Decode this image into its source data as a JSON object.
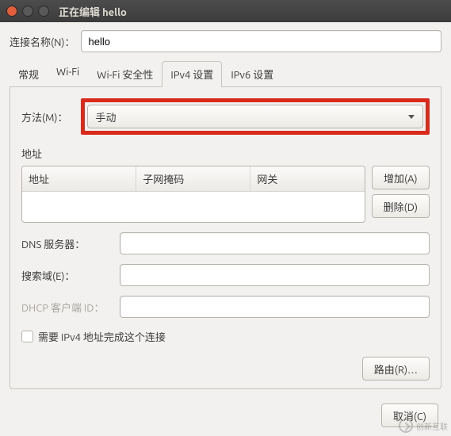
{
  "window": {
    "title": "正在编辑 hello"
  },
  "connection": {
    "label": "连接名称(N)：",
    "value": "hello"
  },
  "tabs": {
    "items": [
      {
        "label": "常规"
      },
      {
        "label": "Wi-Fi"
      },
      {
        "label": "Wi-Fi 安全性"
      },
      {
        "label": "IPv4 设置"
      },
      {
        "label": "IPv6 设置"
      }
    ],
    "active_index": 3
  },
  "method": {
    "label": "方法(M)：",
    "value": "手动"
  },
  "addresses": {
    "section_label": "地址",
    "columns": [
      "地址",
      "子网掩码",
      "网关"
    ],
    "add_label": "增加(A)",
    "delete_label": "删除(D)"
  },
  "dns": {
    "label": "DNS 服务器：",
    "value": ""
  },
  "search": {
    "label": "搜索域(E)：",
    "value": ""
  },
  "dhcp": {
    "label": "DHCP 客户端 ID：",
    "value": ""
  },
  "require_checkbox": {
    "label": "需要 IPv4 地址完成这个连接",
    "checked": false
  },
  "routes_button": "路由(R)…",
  "cancel_button": "取消(C)",
  "watermark": "创新互联"
}
